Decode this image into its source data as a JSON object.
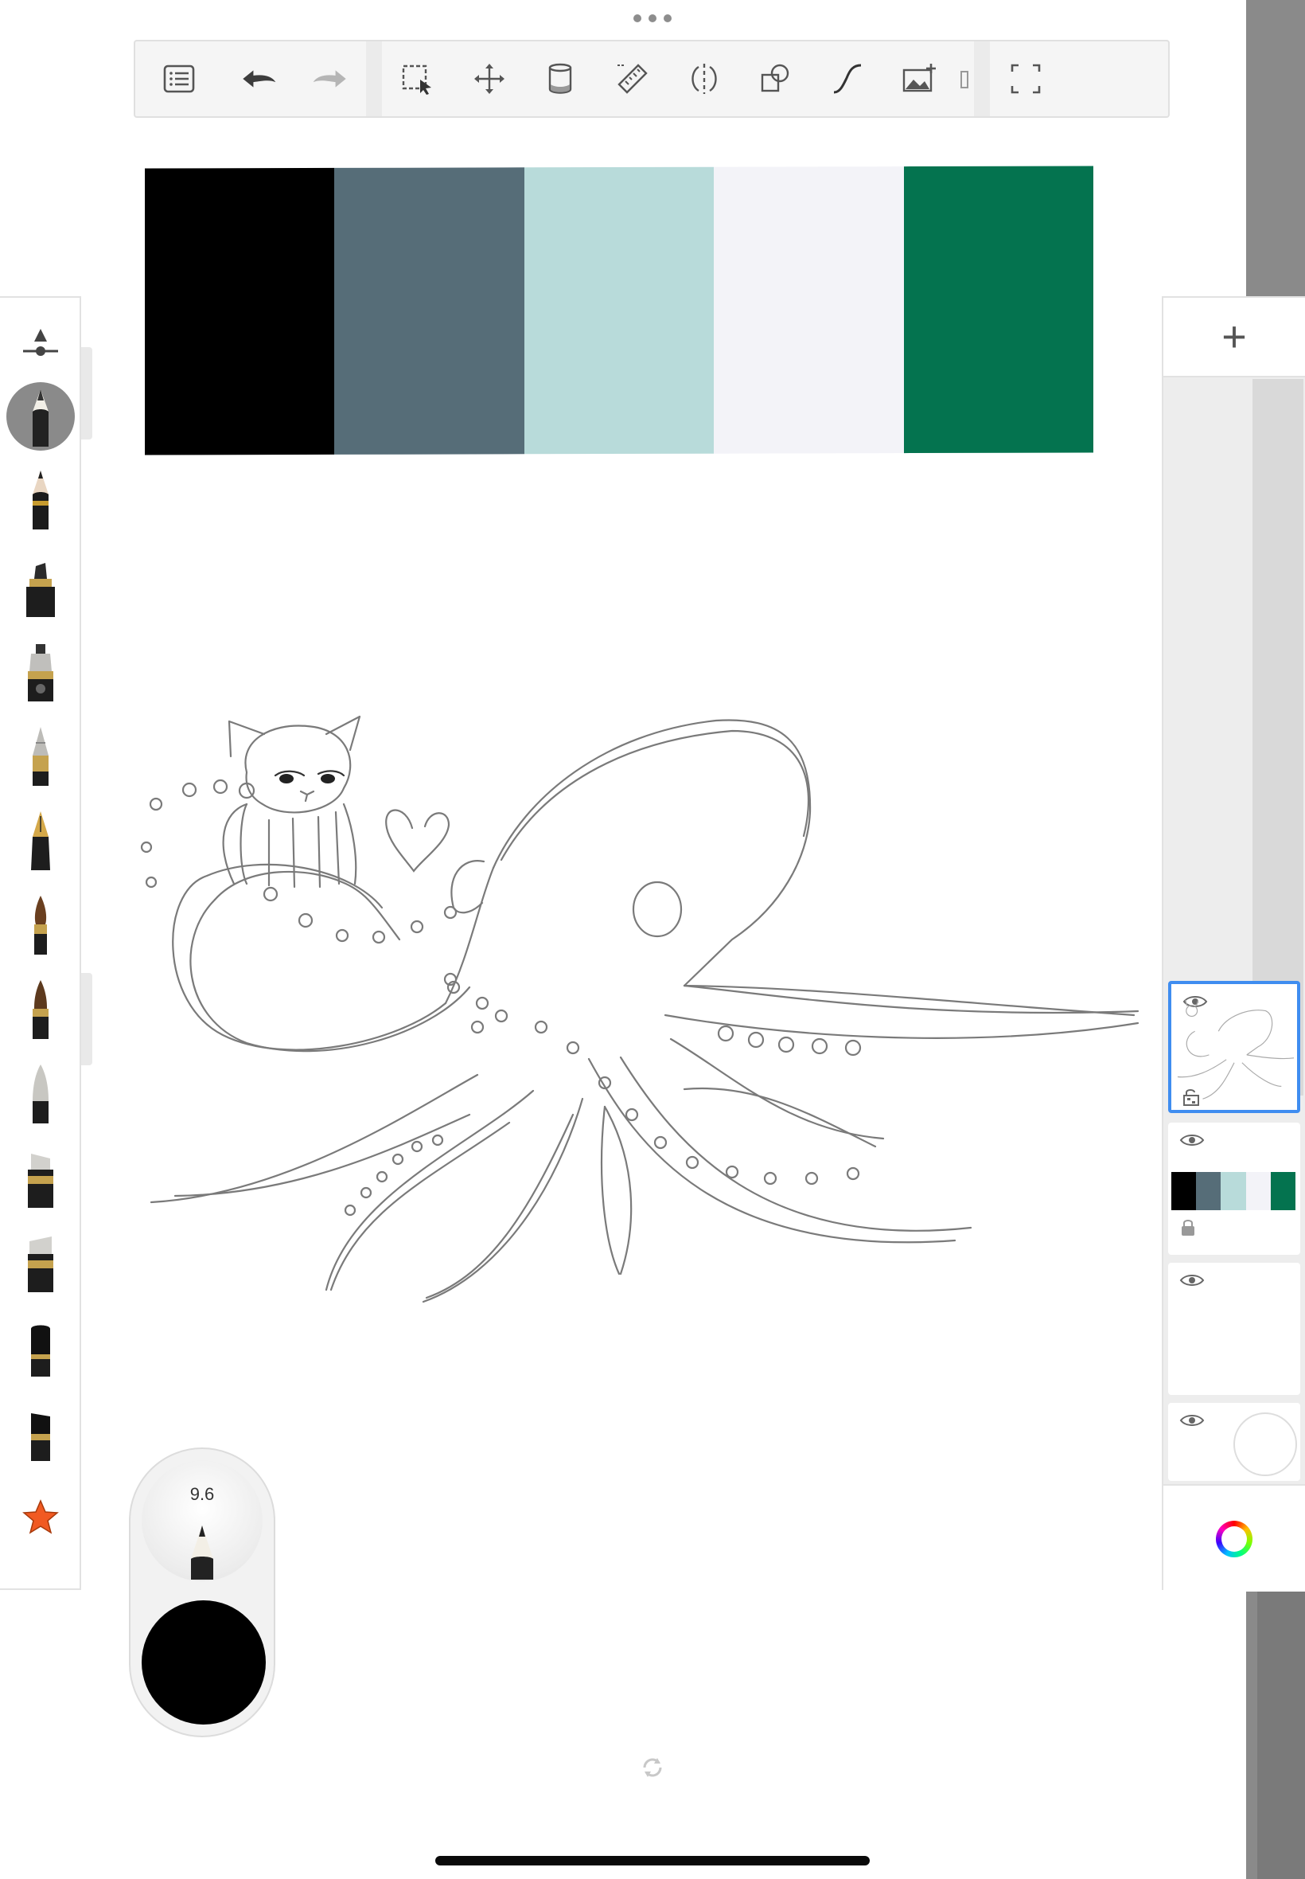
{
  "toolbar": {
    "buttons": [
      {
        "name": "layers-list",
        "icon": "list-icon"
      },
      {
        "name": "undo",
        "icon": "undo-icon"
      },
      {
        "name": "redo",
        "icon": "redo-icon"
      },
      {
        "name": "selection",
        "icon": "selection-icon"
      },
      {
        "name": "transform",
        "icon": "move-icon"
      },
      {
        "name": "fill",
        "icon": "fill-bucket-icon"
      },
      {
        "name": "ruler",
        "icon": "ruler-icon"
      },
      {
        "name": "symmetry",
        "icon": "symmetry-icon"
      },
      {
        "name": "shapes",
        "icon": "shapes-icon"
      },
      {
        "name": "stroke",
        "icon": "curve-icon"
      },
      {
        "name": "add-image",
        "icon": "image-add-icon"
      },
      {
        "name": "fullscreen",
        "icon": "fullscreen-icon"
      }
    ]
  },
  "palette": {
    "colors": [
      "#000000",
      "#566d78",
      "#b8dbda",
      "#f3f3f8",
      "#04734f"
    ]
  },
  "brushes": [
    {
      "name": "size-slider",
      "icon": "brush-size-icon"
    },
    {
      "name": "pencil-selected",
      "icon": "pencil-icon"
    },
    {
      "name": "pencil",
      "icon": "pencil-icon"
    },
    {
      "name": "marker",
      "icon": "marker-icon"
    },
    {
      "name": "fountain-pen",
      "icon": "ink-pen-icon"
    },
    {
      "name": "ballpoint",
      "icon": "ballpoint-icon"
    },
    {
      "name": "nib-pen",
      "icon": "nib-pen-icon"
    },
    {
      "name": "paint-brush",
      "icon": "paint-brush-icon"
    },
    {
      "name": "ink-brush",
      "icon": "ink-brush-icon"
    },
    {
      "name": "airbrush",
      "icon": "airbrush-icon"
    },
    {
      "name": "chisel-marker",
      "icon": "chisel-marker-icon"
    },
    {
      "name": "wide-marker",
      "icon": "wide-marker-icon"
    },
    {
      "name": "flat-marker",
      "icon": "flat-marker-icon"
    },
    {
      "name": "eraser",
      "icon": "eraser-icon"
    },
    {
      "name": "favorites",
      "icon": "star-icon",
      "color": "#f15a22"
    }
  ],
  "layers": {
    "add_label": "+",
    "items": [
      {
        "name": "sketch-layer",
        "active": true
      },
      {
        "name": "palette-layer",
        "active": false,
        "locked": true
      },
      {
        "name": "empty-layer",
        "active": false
      },
      {
        "name": "background-layer",
        "active": false
      }
    ]
  },
  "puck": {
    "brush_size": "9.6",
    "current_color": "#000000"
  },
  "colors": {
    "accent": "#3f8df0",
    "toolbar_bg": "#f5f5f5",
    "icon": "#555555"
  }
}
